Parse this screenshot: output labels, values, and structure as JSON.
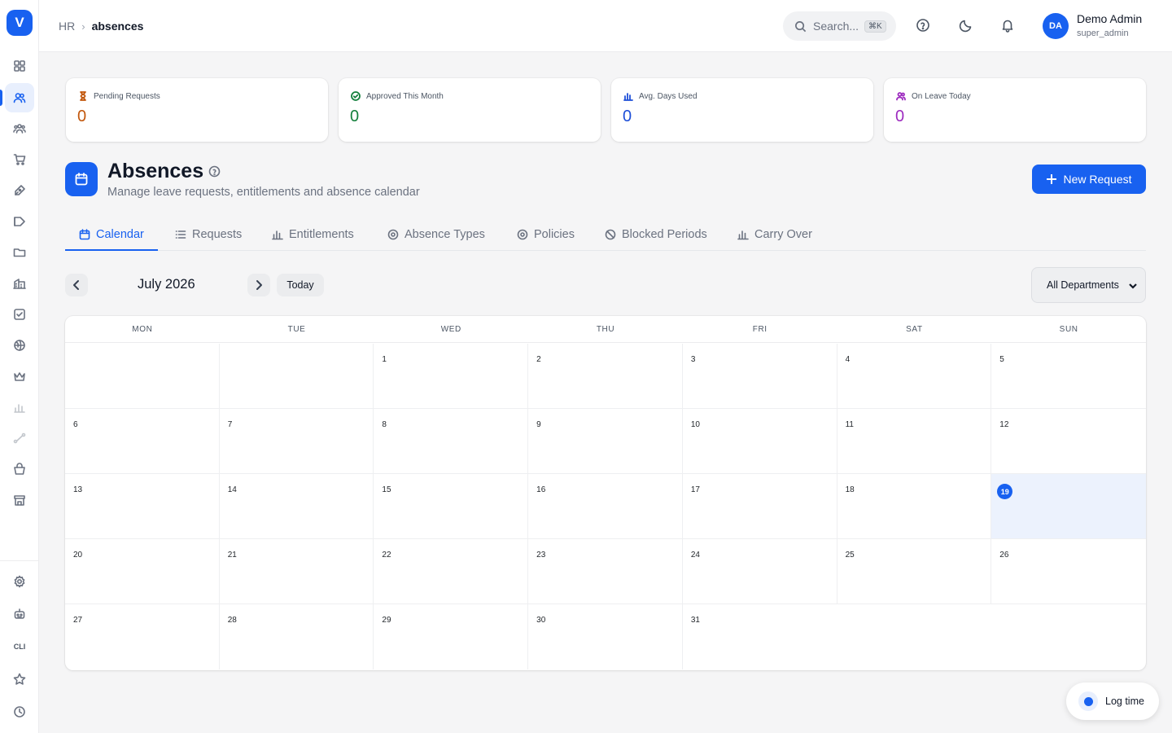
{
  "app": {
    "logo_letter": "V",
    "accent": "#1861f0"
  },
  "sidebar": {
    "items": [
      {
        "icon": "dashboard-icon"
      },
      {
        "icon": "users-icon",
        "active": true
      },
      {
        "icon": "team-icon"
      },
      {
        "icon": "cart-icon"
      },
      {
        "icon": "pen-icon"
      },
      {
        "icon": "campaign-icon"
      },
      {
        "icon": "folder-icon"
      },
      {
        "icon": "building-icon"
      },
      {
        "icon": "checkbox-icon"
      },
      {
        "icon": "globe-icon"
      },
      {
        "icon": "crown-icon"
      },
      {
        "icon": "chart-icon"
      },
      {
        "icon": "route-icon"
      },
      {
        "icon": "basket-icon"
      },
      {
        "icon": "store-icon"
      }
    ],
    "bottom": [
      {
        "icon": "settings-icon"
      },
      {
        "icon": "robot-icon"
      },
      {
        "label": "CLI"
      },
      {
        "icon": "star-icon"
      },
      {
        "icon": "clock-icon"
      }
    ],
    "cli_label": "CLI"
  },
  "header": {
    "breadcrumb": [
      "HR",
      "absences"
    ],
    "search_placeholder": "Search...",
    "search_shortcut": "⌘K",
    "user": {
      "initials": "DA",
      "name": "Demo Admin",
      "role": "super_admin"
    }
  },
  "stats": [
    {
      "label": "Pending Requests",
      "value": "0",
      "color": "#c2570c",
      "icon": "hourglass-icon"
    },
    {
      "label": "Approved This Month",
      "value": "0",
      "color": "#15803d",
      "icon": "check-circle-icon"
    },
    {
      "label": "Avg. Days Used",
      "value": "0",
      "color": "#1d4ed8",
      "icon": "bar-chart-icon"
    },
    {
      "label": "On Leave Today",
      "value": "0",
      "color": "#9d2bbf",
      "icon": "users-icon"
    }
  ],
  "page": {
    "title": "Absences",
    "subtitle": "Manage leave requests, entitlements and absence calendar",
    "new_button": "New Request"
  },
  "tabs": [
    {
      "label": "Calendar",
      "active": true,
      "icon": "calendar-icon"
    },
    {
      "label": "Requests",
      "icon": "list-icon"
    },
    {
      "label": "Entitlements",
      "icon": "bar-chart-icon"
    },
    {
      "label": "Absence Types",
      "icon": "gear-icon"
    },
    {
      "label": "Policies",
      "icon": "gear-icon"
    },
    {
      "label": "Blocked Periods",
      "icon": "ban-icon"
    },
    {
      "label": "Carry Over",
      "icon": "bar-chart-icon"
    }
  ],
  "calendar": {
    "month_label": "July 2026",
    "today_button": "Today",
    "department_filter": "All Departments",
    "weekdays": [
      "MON",
      "TUE",
      "WED",
      "THU",
      "FRI",
      "SAT",
      "SUN"
    ],
    "days": [
      "",
      "",
      "1",
      "2",
      "3",
      "4",
      "5",
      "6",
      "7",
      "8",
      "9",
      "10",
      "11",
      "12",
      "13",
      "14",
      "15",
      "16",
      "17",
      "18",
      "19",
      "20",
      "21",
      "22",
      "23",
      "24",
      "25",
      "26",
      "27",
      "28",
      "29",
      "30",
      "31",
      "",
      "",
      ""
    ],
    "today": "19"
  },
  "log_time": {
    "label": "Log time"
  }
}
